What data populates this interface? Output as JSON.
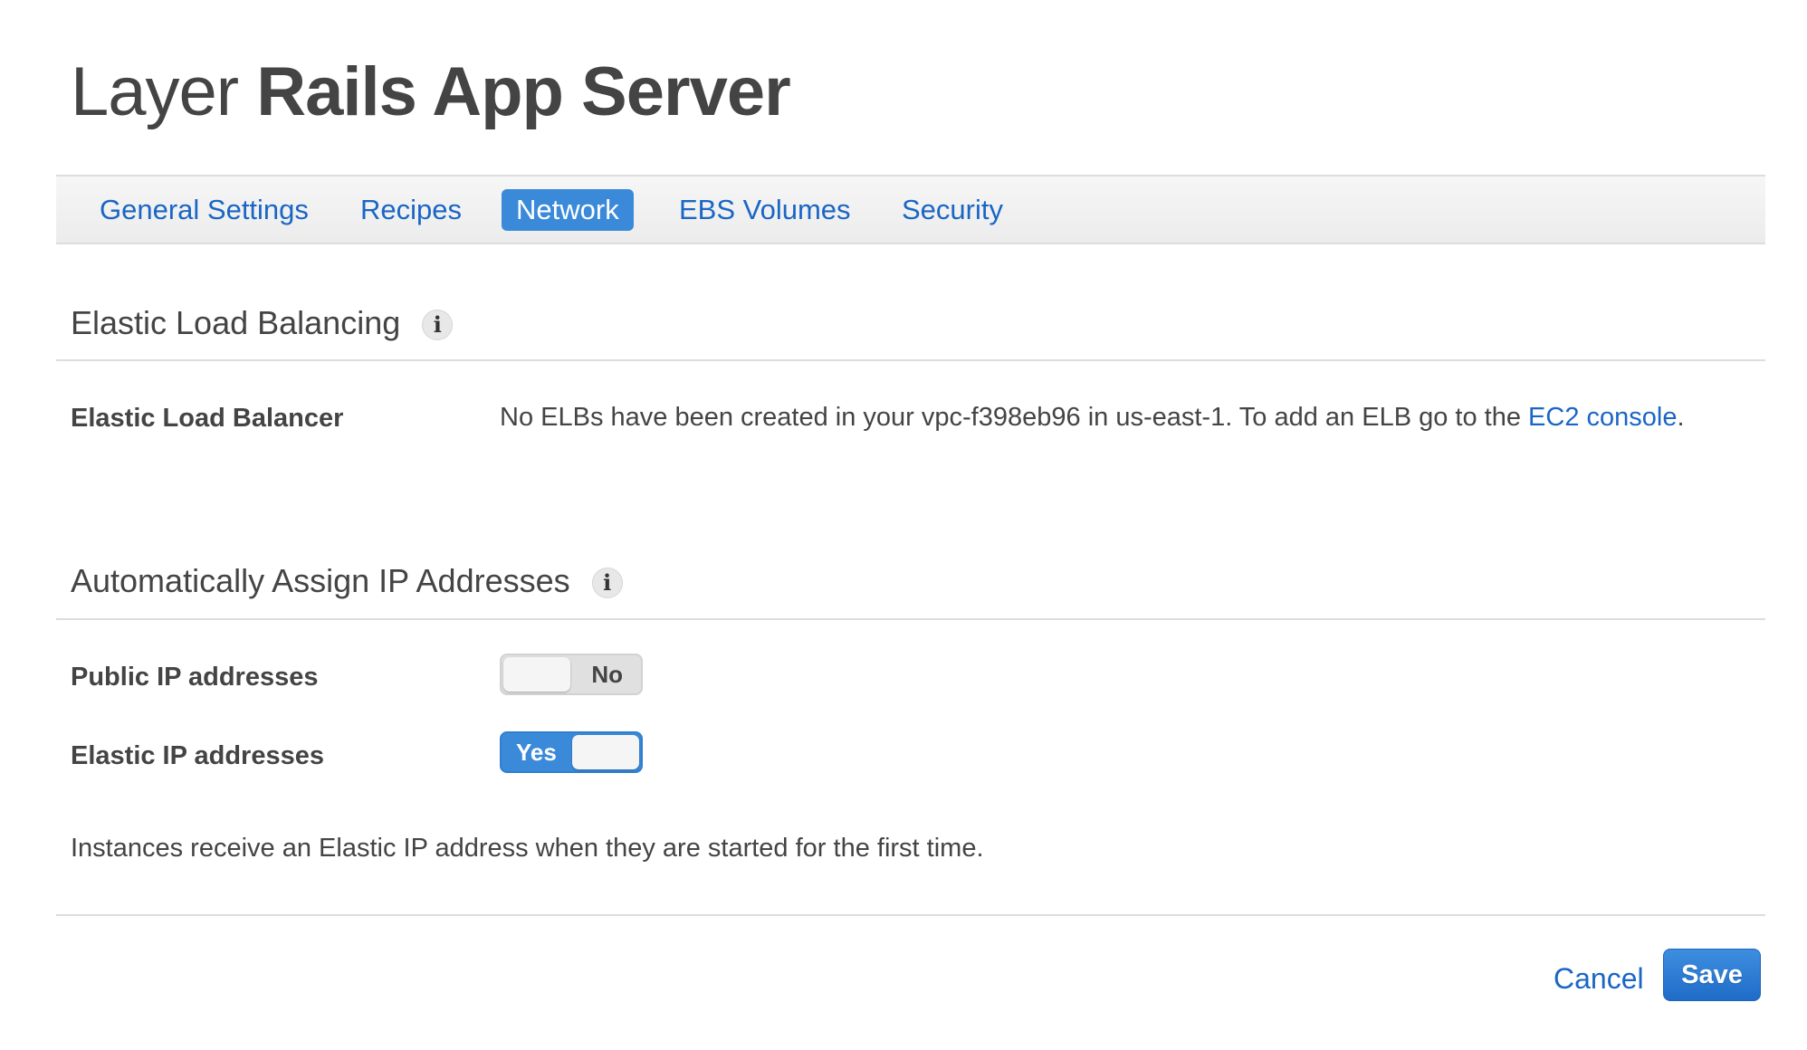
{
  "header": {
    "title_prefix": "Layer",
    "title_name": "Rails App Server"
  },
  "tabs": [
    {
      "label": "General Settings",
      "active": false
    },
    {
      "label": "Recipes",
      "active": false
    },
    {
      "label": "Network",
      "active": true
    },
    {
      "label": "EBS Volumes",
      "active": false
    },
    {
      "label": "Security",
      "active": false
    }
  ],
  "elb_section": {
    "heading": "Elastic Load Balancing",
    "info_icon": "i",
    "field_label": "Elastic Load Balancer",
    "message": "No ELBs have been created in your vpc-f398eb96 in us-east-1. To add an ELB go to the ",
    "link_text": "EC2 console",
    "message_end": "."
  },
  "ip_section": {
    "heading": "Automatically Assign IP Addresses",
    "info_icon": "i",
    "public_ip": {
      "label": "Public IP addresses",
      "value": false,
      "state_text": "No"
    },
    "elastic_ip": {
      "label": "Elastic IP addresses",
      "value": true,
      "state_text": "Yes"
    },
    "note": "Instances receive an Elastic IP address when they are started for the first time."
  },
  "footer": {
    "cancel_label": "Cancel",
    "save_label": "Save"
  },
  "colors": {
    "accent": "#3a8ad9",
    "link": "#1a66c5",
    "text": "#444444"
  }
}
